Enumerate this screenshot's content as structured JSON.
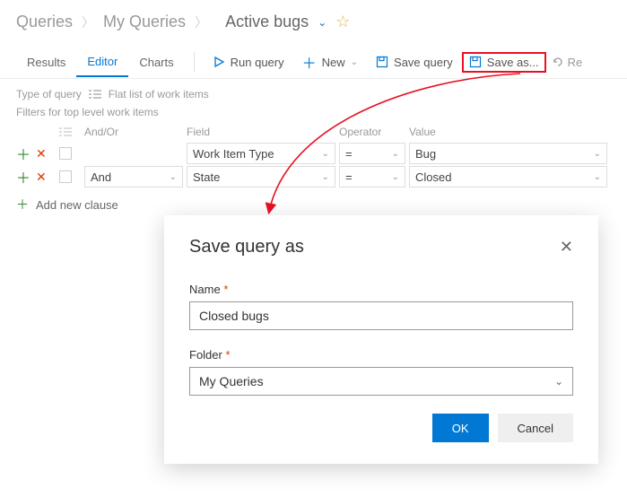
{
  "breadcrumb": {
    "root": "Queries",
    "mid": "My Queries",
    "current": "Active bugs"
  },
  "tabs": {
    "results": "Results",
    "editor": "Editor",
    "charts": "Charts"
  },
  "toolbar": {
    "run": "Run query",
    "new": "New",
    "save": "Save query",
    "saveas": "Save as...",
    "re": "Re"
  },
  "typeRow": {
    "label": "Type of query",
    "value": "Flat list of work items"
  },
  "filtersLabel": "Filters for top level work items",
  "headers": {
    "andor": "And/Or",
    "field": "Field",
    "operator": "Operator",
    "value": "Value"
  },
  "rows": [
    {
      "andor": "",
      "field": "Work Item Type",
      "op": "=",
      "value": "Bug"
    },
    {
      "andor": "And",
      "field": "State",
      "op": "=",
      "value": "Closed"
    }
  ],
  "addClause": "Add new clause",
  "dialog": {
    "title": "Save query as",
    "nameLabel": "Name",
    "nameValue": "Closed bugs",
    "folderLabel": "Folder",
    "folderValue": "My Queries",
    "ok": "OK",
    "cancel": "Cancel"
  }
}
